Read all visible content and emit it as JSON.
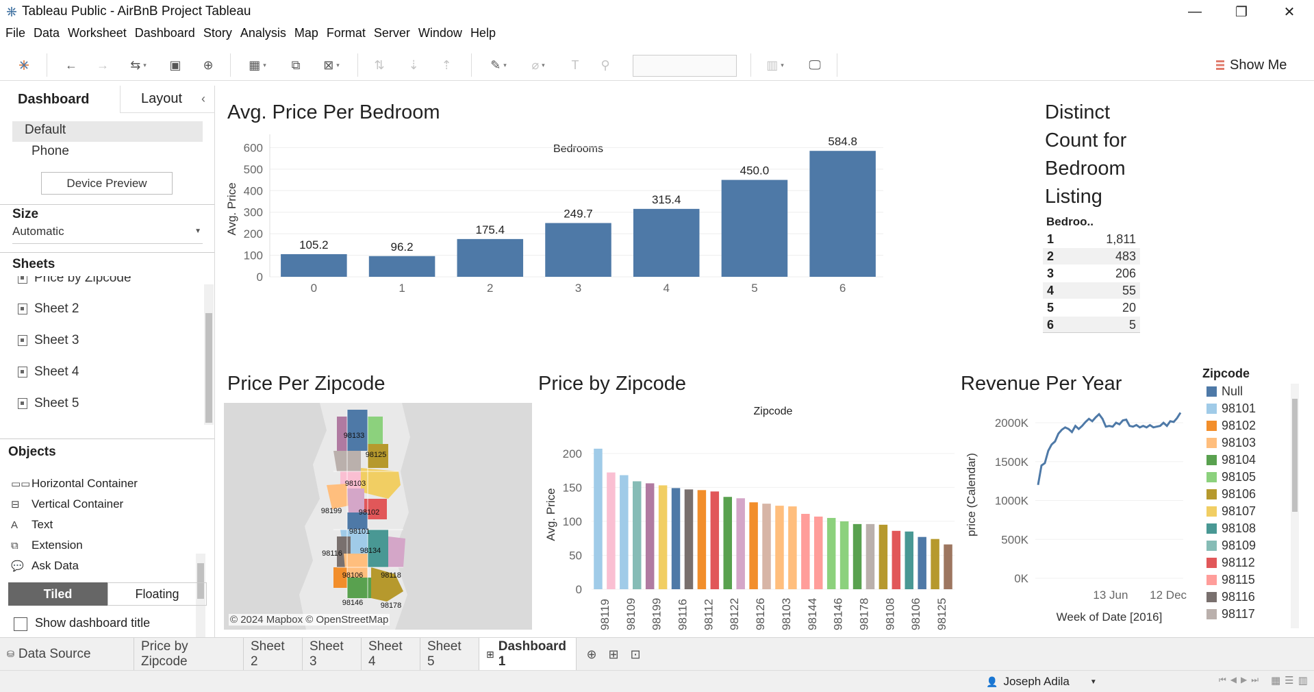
{
  "window": {
    "title": "Tableau Public - AirBnB Project Tableau",
    "minimize": "—",
    "maximize": "❐",
    "close": "✕"
  },
  "menu": [
    "File",
    "Data",
    "Worksheet",
    "Dashboard",
    "Story",
    "Analysis",
    "Map",
    "Format",
    "Server",
    "Window",
    "Help"
  ],
  "toolbar": {
    "show_me": "Show Me"
  },
  "left_panel": {
    "tabs": {
      "dashboard": "Dashboard",
      "layout": "Layout",
      "collapse": "‹"
    },
    "devices": [
      "Default",
      "Phone"
    ],
    "device_preview": "Device Preview",
    "size": {
      "title": "Size",
      "value": "Automatic"
    },
    "sheets": {
      "title": "Sheets",
      "partial_item": "Price by Zipcode",
      "items": [
        "Sheet 2",
        "Sheet 3",
        "Sheet 4",
        "Sheet 5"
      ]
    },
    "objects": {
      "title": "Objects",
      "items": [
        {
          "icon": "horizontal-container-icon",
          "label": "Horizontal Container"
        },
        {
          "icon": "vertical-container-icon",
          "label": "Vertical Container"
        },
        {
          "icon": "text-icon",
          "label": "Text"
        },
        {
          "icon": "extension-icon",
          "label": "Extension"
        },
        {
          "icon": "ask-data-icon",
          "label": "Ask Data"
        }
      ]
    },
    "tiled": "Tiled",
    "floating": "Floating",
    "show_title": "Show dashboard title"
  },
  "dashboard": {
    "titles": {
      "bedroom": "Avg. Price Per Bedroom",
      "zipmap": "Price Per Zipcode",
      "zipbar": "Price by Zipcode",
      "revenue": "Revenue Per Year"
    },
    "distinct": {
      "title_lines": [
        "Distinct",
        "Count for",
        "Bedroom",
        "Listing"
      ],
      "header": "Bedroo..",
      "rows": [
        {
          "k": "1",
          "v": "1,811"
        },
        {
          "k": "2",
          "v": "483"
        },
        {
          "k": "3",
          "v": "206"
        },
        {
          "k": "4",
          "v": "55"
        },
        {
          "k": "5",
          "v": "20"
        },
        {
          "k": "6",
          "v": "5"
        }
      ]
    },
    "map": {
      "credit": "© 2024 Mapbox © OpenStreetMap",
      "labels": [
        "98133",
        "98125",
        "98103",
        "98199",
        "98102",
        "98101",
        "98116",
        "98134",
        "98106",
        "98118",
        "98146",
        "98178"
      ]
    },
    "legend": {
      "title": "Zipcode",
      "items": [
        {
          "label": "Null",
          "color": "#4e79a7"
        },
        {
          "label": "98101",
          "color": "#a0cbe8"
        },
        {
          "label": "98102",
          "color": "#f28e2b"
        },
        {
          "label": "98103",
          "color": "#ffbe7d"
        },
        {
          "label": "98104",
          "color": "#59a14f"
        },
        {
          "label": "98105",
          "color": "#8cd17d"
        },
        {
          "label": "98106",
          "color": "#b6992d"
        },
        {
          "label": "98107",
          "color": "#f1ce63"
        },
        {
          "label": "98108",
          "color": "#499894"
        },
        {
          "label": "98109",
          "color": "#86bcb6"
        },
        {
          "label": "98112",
          "color": "#e15759"
        },
        {
          "label": "98115",
          "color": "#ff9d9a"
        },
        {
          "label": "98116",
          "color": "#79706e"
        },
        {
          "label": "98117",
          "color": "#bab0ac"
        }
      ]
    }
  },
  "bottom_tabs": {
    "data_source": "Data Source",
    "sheets": [
      "Price by Zipcode",
      "Sheet 2",
      "Sheet 3",
      "Sheet 4",
      "Sheet 5"
    ],
    "active": "Dashboard 1"
  },
  "status": {
    "user": "Joseph Adila"
  },
  "chart_data": [
    {
      "type": "bar",
      "title": "Avg. Price Per Bedroom",
      "column_header": "Bedrooms",
      "ylabel": "Avg. Price",
      "categories": [
        "0",
        "1",
        "2",
        "3",
        "4",
        "5",
        "6"
      ],
      "values": [
        105.2,
        96.2,
        175.4,
        249.7,
        315.4,
        450.0,
        584.8
      ],
      "labels": [
        "105.2",
        "96.2",
        "175.4",
        "249.7",
        "315.4",
        "450.0",
        "584.8"
      ],
      "yticks": [
        0,
        100,
        200,
        300,
        400,
        500,
        600
      ],
      "ylim": [
        0,
        630
      ],
      "color": "#4e79a7"
    },
    {
      "type": "bar",
      "title": "Price by Zipcode",
      "column_header": "Zipcode",
      "ylabel": "Avg. Price",
      "categories": [
        "98119",
        "98109",
        "98199",
        "98116",
        "98112",
        "98122",
        "98126",
        "98103",
        "98144",
        "98146",
        "98178",
        "98108",
        "98106",
        "98125"
      ],
      "values": [
        207,
        172,
        168,
        159,
        156,
        153,
        149,
        147,
        146,
        144,
        136,
        134,
        128,
        126,
        123,
        122,
        111,
        107,
        105,
        100,
        96,
        96,
        95,
        86,
        85,
        77,
        74,
        66
      ],
      "colors": [
        "#a0cbe8",
        "#fabfd2",
        "#a0cbe8",
        "#86bcb6",
        "#b07aa1",
        "#f1ce63",
        "#4e79a7",
        "#79706e",
        "#f28e2b",
        "#e15759",
        "#59a14f",
        "#d4a6c8",
        "#f28e2b",
        "#d7b5a6",
        "#ffbe7d",
        "#ffbe7d",
        "#ff9d9a",
        "#ff9d9a",
        "#8cd17d",
        "#8cd17d",
        "#59a14f",
        "#bab0ac",
        "#b6992d",
        "#e15759",
        "#499894",
        "#4e79a7",
        "#b6992d",
        "#9d7660"
      ],
      "yticks": [
        0,
        50,
        100,
        150,
        200
      ],
      "ylim": [
        0,
        220
      ]
    },
    {
      "type": "line",
      "title": "Revenue Per Year",
      "xlabel": "Week of Date [2016]",
      "ylabel": "price (Calendar)",
      "xtick_labels": [
        "13 Jun",
        "12 Dec"
      ],
      "ytick_labels": [
        "0K",
        "500K",
        "1000K",
        "1500K",
        "2000K"
      ],
      "yticks": [
        0,
        500,
        1000,
        1500,
        2000
      ],
      "ylim": [
        0,
        2150
      ],
      "values": [
        1200,
        1450,
        1480,
        1640,
        1720,
        1760,
        1860,
        1910,
        1940,
        1920,
        1880,
        1960,
        1920,
        1960,
        2010,
        2050,
        2020,
        2070,
        2110,
        2050,
        1950,
        1960,
        1950,
        2000,
        1980,
        2030,
        2040,
        1960,
        1950,
        1970,
        1940,
        1960,
        1940,
        1970,
        1940,
        1950,
        1960,
        2000,
        1960,
        2020,
        2010,
        2060,
        2130
      ],
      "color": "#4e79a7"
    }
  ]
}
